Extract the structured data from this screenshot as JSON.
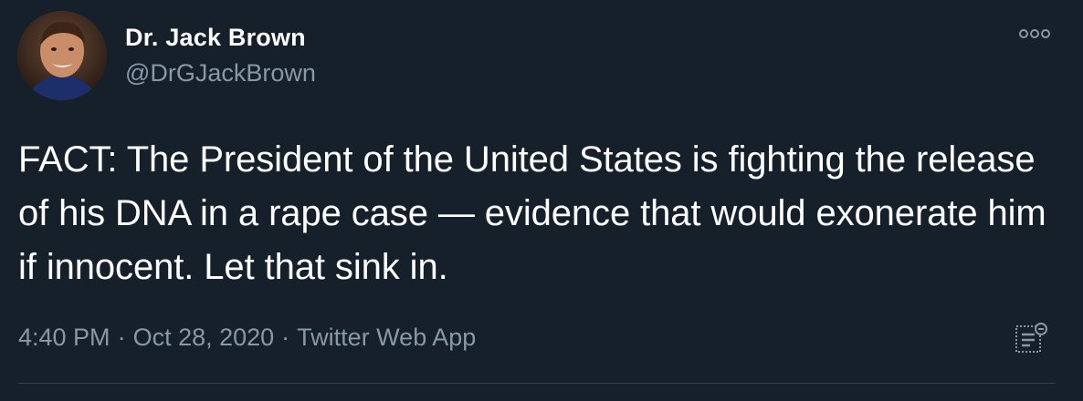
{
  "author": {
    "display_name": "Dr. Jack Brown",
    "handle": "@DrGJackBrown",
    "avatar_icon": "profile-photo"
  },
  "tweet": {
    "text": "FACT: The President of the United States is fighting the release of his DNA in a rape case — evidence that would exonerate him if innocent. Let that sink in.",
    "time": "4:40 PM",
    "separator": "·",
    "date": "Oct 28, 2020",
    "source": "Twitter Web App"
  },
  "icons": {
    "more": "more-options-icon",
    "analytics": "tweet-analytics-icon"
  },
  "colors": {
    "background": "#15202b",
    "primary_text": "#ffffff",
    "secondary_text": "#8899a6",
    "divider": "#38444d"
  }
}
